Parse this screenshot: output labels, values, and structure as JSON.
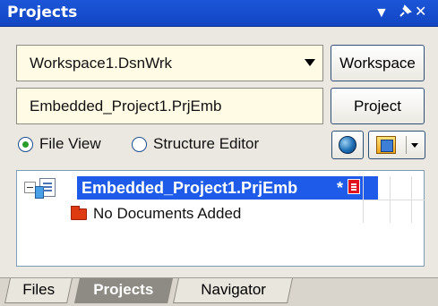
{
  "panel": {
    "title": "Projects",
    "controls": {
      "menu": "▼",
      "pin": "📌",
      "close": "✕"
    }
  },
  "workspace": {
    "selected": "Workspace1.DsnWrk",
    "button_label": "Workspace"
  },
  "project": {
    "current": "Embedded_Project1.PrjEmb",
    "button_label": "Project"
  },
  "view_mode": {
    "options": [
      "File View",
      "Structure Editor"
    ],
    "selected": "File View"
  },
  "tree": {
    "root": {
      "name": "Embedded_Project1.PrjEmb",
      "modified_marker": "*",
      "expanded": true,
      "selected": true
    },
    "child": "No Documents Added"
  },
  "tabs": {
    "items": [
      "Files",
      "Projects",
      "Navigator"
    ],
    "active": "Projects"
  },
  "colors": {
    "title_bar": "#1c56d8",
    "selection": "#1d5be8",
    "field_bg": "#fffbe4",
    "folder": "#de3b13"
  }
}
